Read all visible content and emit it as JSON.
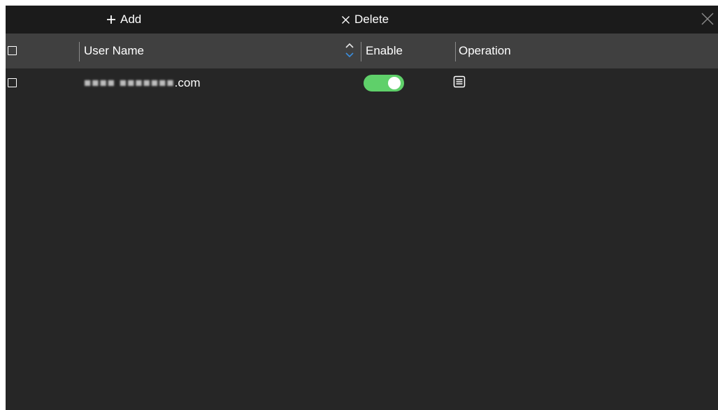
{
  "toolbar": {
    "add_label": "Add",
    "add_icon": "plus-icon",
    "delete_label": "Delete",
    "delete_icon": "x-icon",
    "close_icon": "close-icon"
  },
  "table": {
    "columns": {
      "user_name": "User Name",
      "enable": "Enable",
      "operation": "Operation"
    },
    "rows": [
      {
        "user_name_visible": ".com",
        "enabled": true,
        "operation_icon": "edit-list-icon"
      }
    ]
  },
  "colors": {
    "panel_bg": "#262626",
    "toolbar_bg": "#1b1b1b",
    "header_bg": "#404040",
    "toggle_on": "#5fd06a",
    "sort_active": "#3b8ddc"
  }
}
